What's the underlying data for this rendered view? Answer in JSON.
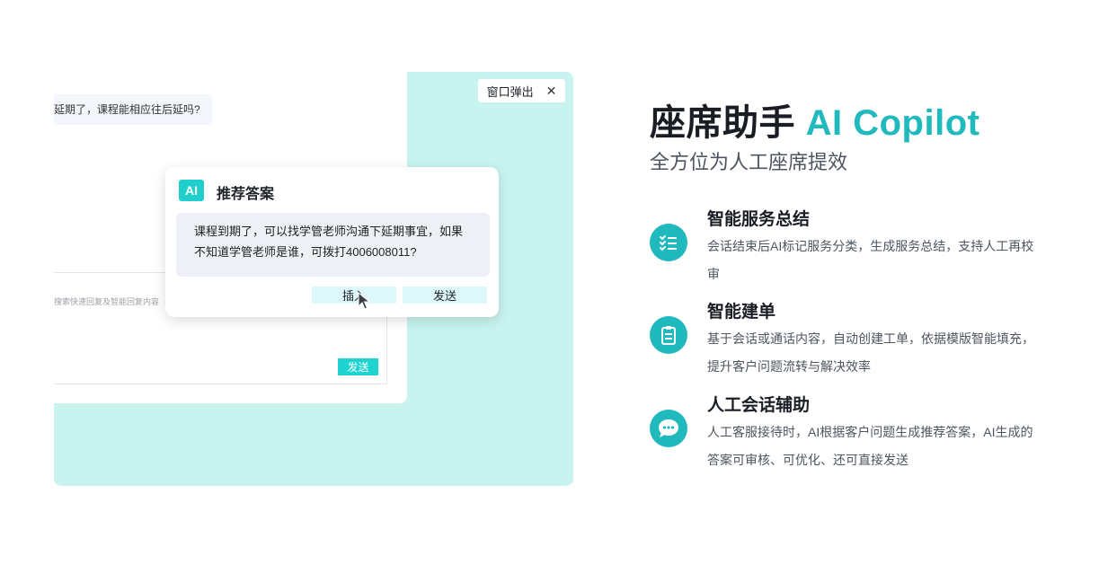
{
  "demo": {
    "customer_message": "延期了，课程能相应往后延吗?",
    "popout_label": "窗口弹出",
    "input_hint": "搜索快速回复及智能回复内容",
    "send_label": "发送",
    "recommend": {
      "badge": "AI",
      "title": "推荐答案",
      "answer": "课程到期了，可以找学管老师沟通下延期事宜，如果不知道学管老师是谁，可拨打4006008011?",
      "insert_label": "插入",
      "send_label": "发送"
    }
  },
  "hero": {
    "title_main": "座席助手",
    "title_accent": "AI Copilot",
    "subtitle": "全方位为人工座席提效"
  },
  "features": [
    {
      "icon": "checklist-icon",
      "title": "智能服务总结",
      "desc": "会话结束后AI标记服务分类，生成服务总结，支持人工再校审"
    },
    {
      "icon": "clipboard-icon",
      "title": "智能建单",
      "desc": "基于会话或通话内容，自动创建工单，依据模版智能填充，提升客户问题流转与解决效率"
    },
    {
      "icon": "chat-bubble-icon",
      "title": "人工会话辅助",
      "desc": "人工客服接待时，AI根据客户问题生成推荐答案，AI生成的答案可审核、可优化、还可直接发送"
    }
  ],
  "colors": {
    "accent": "#20b9bd",
    "mint": "#c8f3ef",
    "badge": "#20cfcb"
  }
}
